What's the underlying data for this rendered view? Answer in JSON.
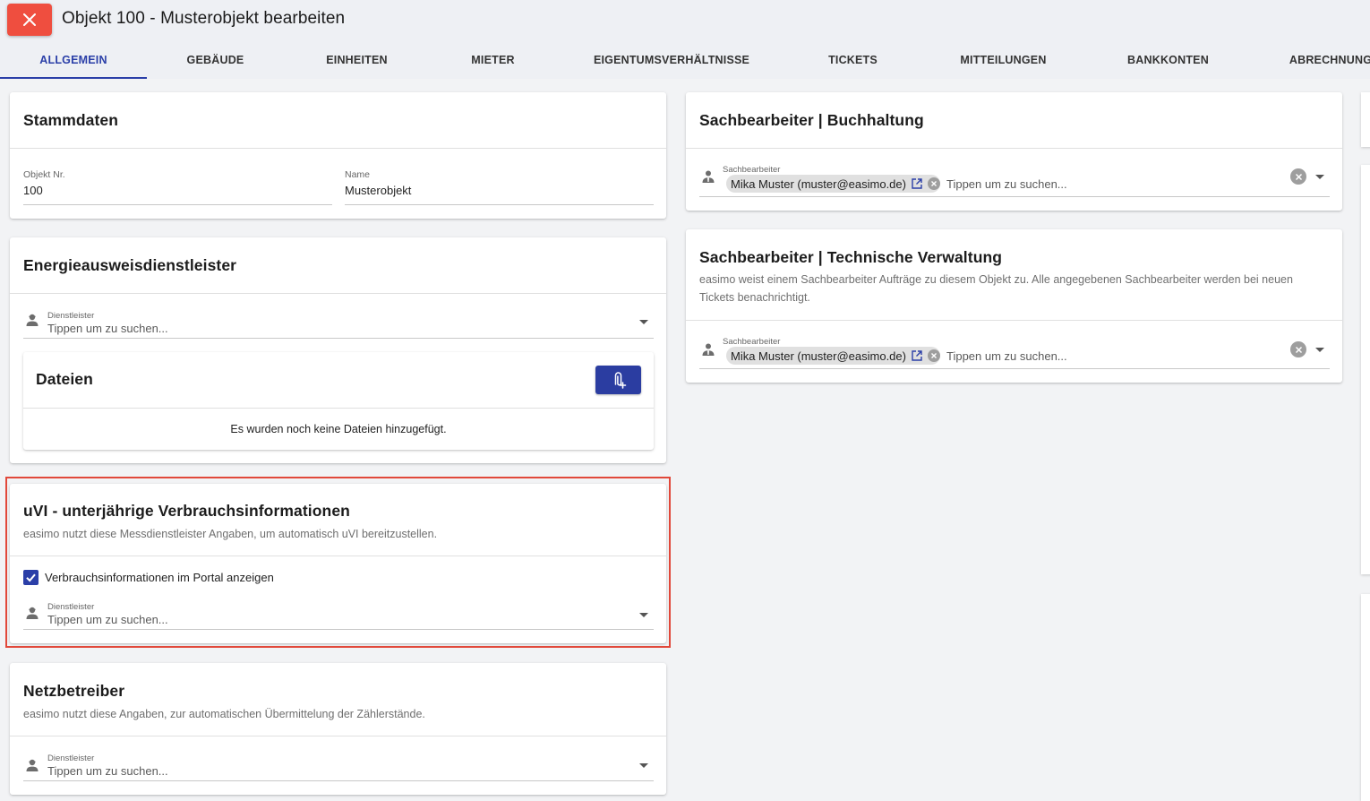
{
  "header": {
    "title": "Objekt 100 - Musterobjekt bearbeiten"
  },
  "tabs": [
    {
      "label": "ALLGEMEIN",
      "active": true
    },
    {
      "label": "GEBÄUDE"
    },
    {
      "label": "EINHEITEN"
    },
    {
      "label": "MIETER"
    },
    {
      "label": "EIGENTUMSVERHÄLTNISSE"
    },
    {
      "label": "TICKETS"
    },
    {
      "label": "MITTEILUNGEN"
    },
    {
      "label": "BANKKONTEN"
    },
    {
      "label": "ABRECHNUNG"
    }
  ],
  "stammdaten": {
    "title": "Stammdaten",
    "objekt_nr_label": "Objekt Nr.",
    "objekt_nr_value": "100",
    "name_label": "Name",
    "name_value": "Musterobjekt"
  },
  "energie": {
    "title": "Energieausweisdienstleister",
    "field_label": "Dienstleister",
    "placeholder": "Tippen um zu suchen...",
    "files_title": "Dateien",
    "files_empty": "Es wurden noch keine Dateien hinzugefügt."
  },
  "uvi": {
    "title": "uVI - unterjährige Verbrauchsinformationen",
    "subtitle": "easimo nutzt diese Messdienstleister Angaben, um automatisch uVI bereitzustellen.",
    "checkbox_label": "Verbrauchsinformationen im Portal anzeigen",
    "checkbox_checked": true,
    "field_label": "Dienstleister",
    "placeholder": "Tippen um zu suchen..."
  },
  "netz": {
    "title": "Netzbetreiber",
    "subtitle": "easimo nutzt diese Angaben, zur automatischen Übermittelung der Zählerstände.",
    "field_label": "Dienstleister",
    "placeholder": "Tippen um zu suchen..."
  },
  "buchhaltung": {
    "title": "Sachbearbeiter | Buchhaltung",
    "field_label": "Sachbearbeiter",
    "chip": "Mika Muster (muster@easimo.de)",
    "placeholder": "Tippen um zu suchen..."
  },
  "technik": {
    "title": "Sachbearbeiter | Technische Verwaltung",
    "subtitle": "easimo weist einem Sachbearbeiter Aufträge zu diesem Objekt zu. Alle angegebenen Sachbearbeiter werden bei neuen Tickets benachrichtigt.",
    "field_label": "Sachbearbeiter",
    "chip": "Mika Muster (muster@easimo.de)",
    "placeholder": "Tippen um zu suchen..."
  },
  "colors": {
    "accent": "#2b3fa8",
    "close": "#ef4e3f",
    "highlight": "#e1483a"
  }
}
